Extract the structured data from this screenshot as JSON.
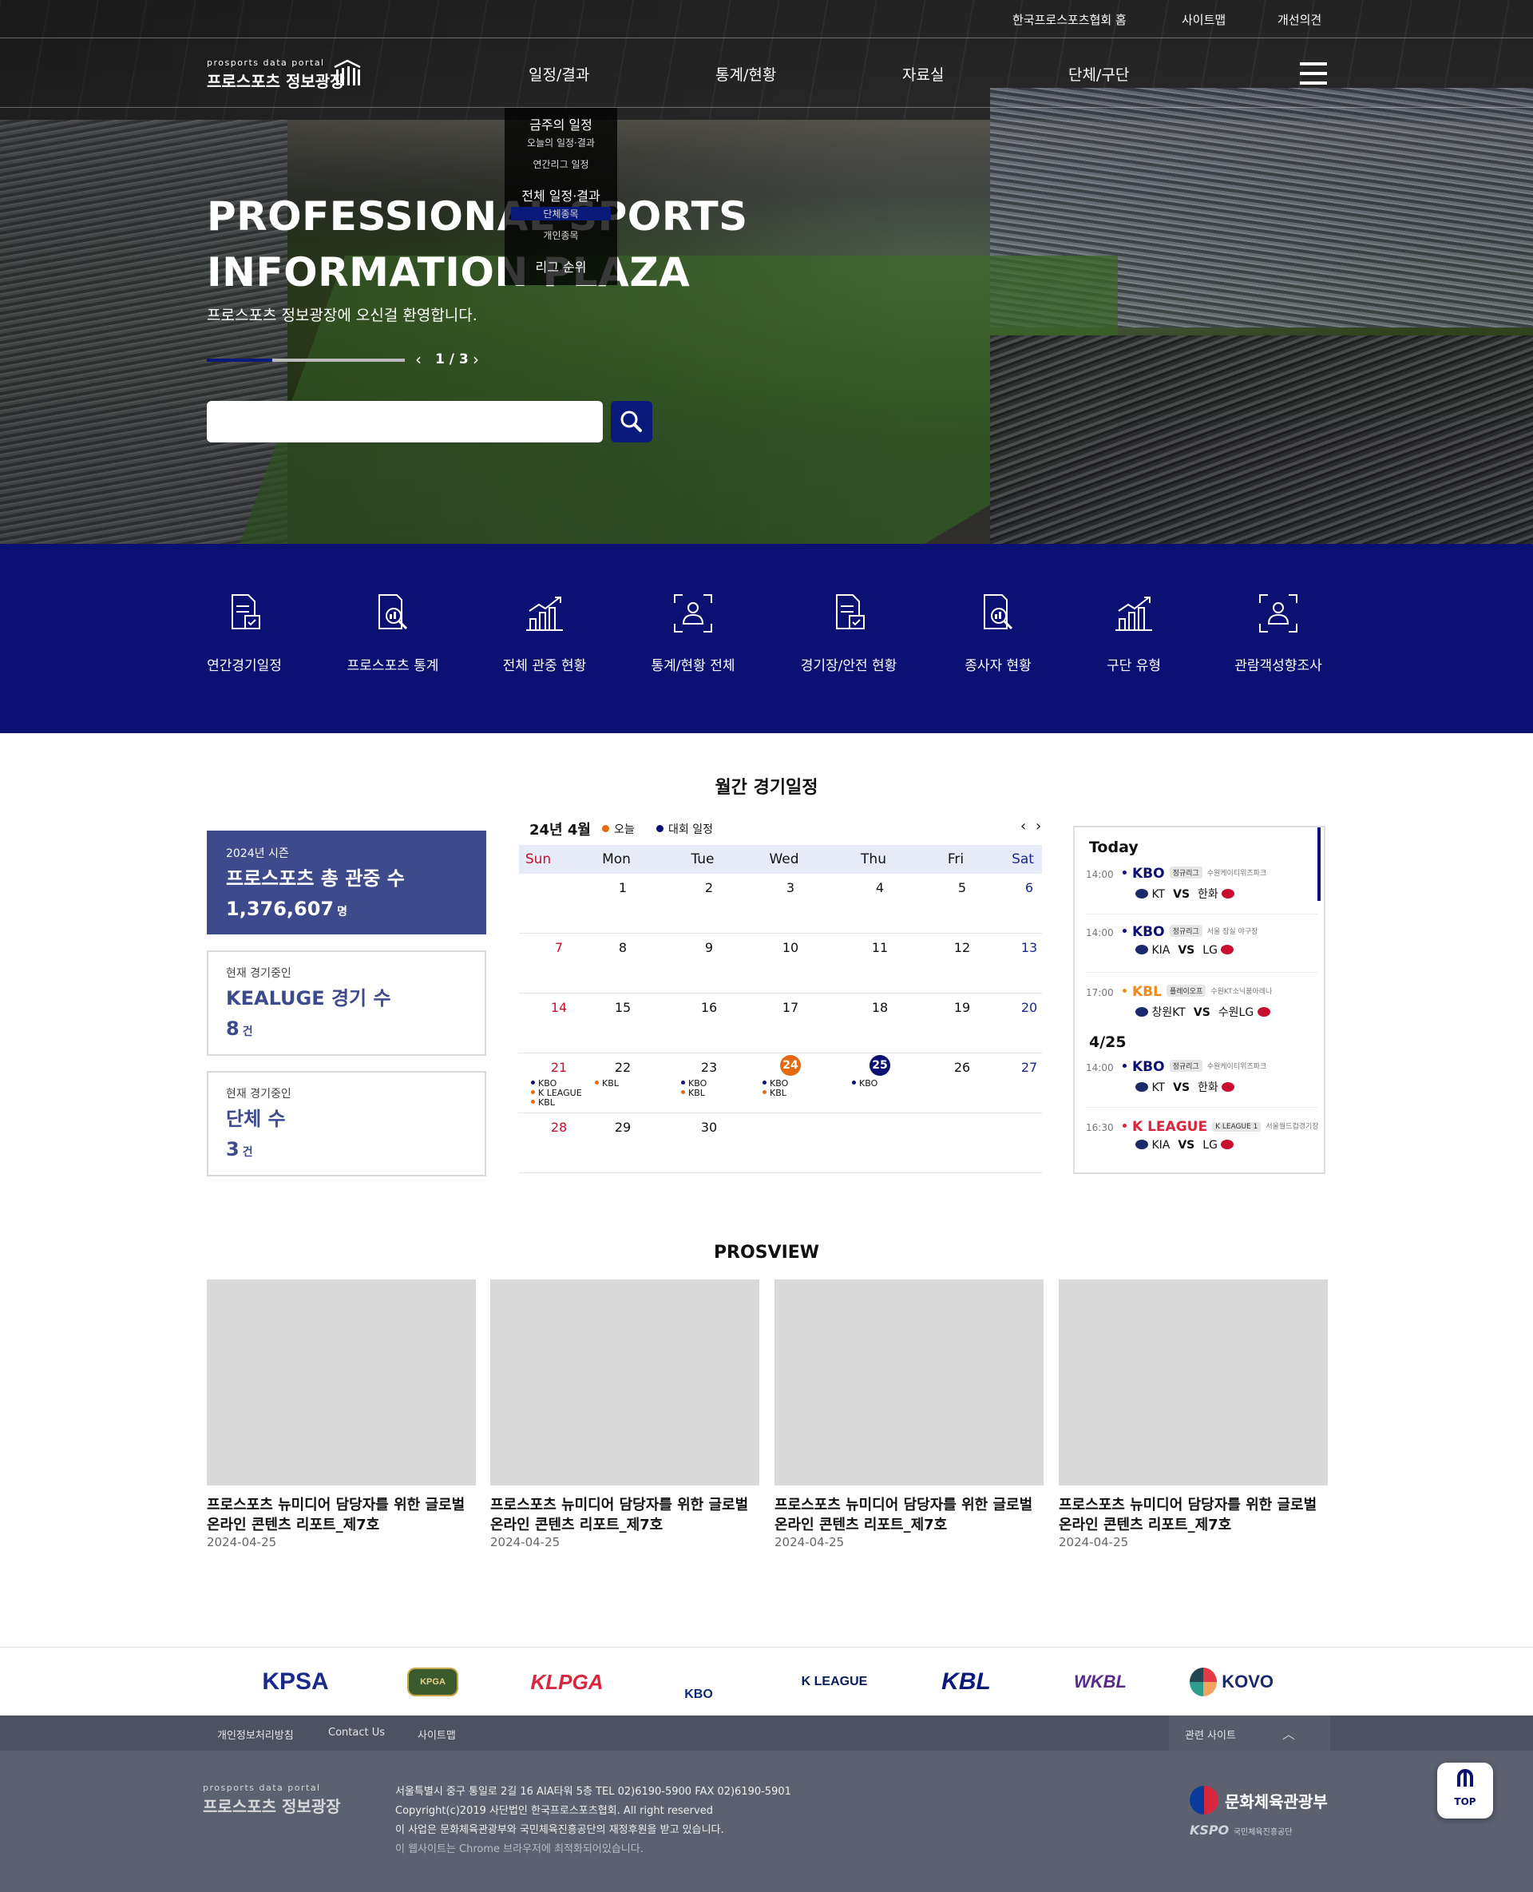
{
  "topbar": {
    "links": [
      "한국프로스포츠협회 홈",
      "사이트맵",
      "개선의견"
    ]
  },
  "logo": {
    "small": "prosports data portal",
    "big": "프로스포츠 정보광장"
  },
  "gnb": {
    "menus": [
      "일정/결과",
      "통계/현황",
      "자료실",
      "단체/구단"
    ]
  },
  "dropdown": {
    "items": [
      {
        "label": "금주의 일정",
        "level": "main"
      },
      {
        "label": "오늘의 일정·결과",
        "level": "sub"
      },
      {
        "label": "연간리그 일정",
        "level": "sub"
      },
      {
        "label": "전체 일정·결과",
        "level": "main"
      },
      {
        "label": "단체종목",
        "level": "sub",
        "highlight": true
      },
      {
        "label": "개인종목",
        "level": "sub"
      },
      {
        "label": "리그 순위",
        "level": "main"
      }
    ]
  },
  "hero": {
    "title_line1": "PROFESSIONAL SPORTS",
    "title_line2": "INFORMATION PLAZA",
    "subtitle": "프로스포츠 정보광장에 오신걸 환영합니다.",
    "pager": "1 / 3",
    "progress": 0.33,
    "search_placeholder": ""
  },
  "quick_menu": [
    {
      "label": "연간경기일정",
      "icon": "document-check-icon"
    },
    {
      "label": "프로스포츠 통계",
      "icon": "chart-search-icon"
    },
    {
      "label": "전체 관중 현황",
      "icon": "bar-chart-up-icon"
    },
    {
      "label": "통계/현황 전체",
      "icon": "person-frame-icon"
    },
    {
      "label": "경기장/안전 현황",
      "icon": "document-check-icon"
    },
    {
      "label": "종사자 현황",
      "icon": "chart-search-icon"
    },
    {
      "label": "구단 유형",
      "icon": "bar-chart-up-icon"
    },
    {
      "label": "관람객성향조사",
      "icon": "person-frame-icon"
    }
  ],
  "monthly": {
    "title": "월간 경기일정",
    "stats": [
      {
        "small": "2024년 시즌",
        "title": "프로스포츠 총 관중 수",
        "value": "1,376,607",
        "unit": "명"
      },
      {
        "small": "현재 경기중인",
        "title": "KEALUGE 경기 수",
        "value": "8",
        "unit": "건"
      },
      {
        "small": "현재 경기중인",
        "title": "단체 수",
        "value": "3",
        "unit": "건"
      }
    ],
    "calendar": {
      "month_label": "24년 4월",
      "legend_today": "오늘",
      "legend_event": "대회 일정",
      "today_color": "#e46a12",
      "event_color": "#0a1172",
      "daynames": [
        "Sun",
        "Mon",
        "Tue",
        "Wed",
        "Thu",
        "Fri",
        "Sat"
      ],
      "weeks": [
        [
          "",
          "1",
          "2",
          "3",
          "4",
          "5",
          "6"
        ],
        [
          "7",
          "8",
          "9",
          "10",
          "11",
          "12",
          "13"
        ],
        [
          "14",
          "15",
          "16",
          "17",
          "18",
          "19",
          "20"
        ],
        [
          "21",
          "22",
          "23",
          "24",
          "25",
          "26",
          "27"
        ],
        [
          "28",
          "29",
          "30",
          "",
          "",
          "",
          ""
        ]
      ],
      "events": {
        "21": [
          "KBO",
          "K LEAGUE",
          "KBL"
        ],
        "22": [
          "KBL"
        ],
        "23": [
          "KBO",
          "KBL"
        ],
        "24": [
          "KBO",
          "KBL"
        ],
        "25": [
          "KBO"
        ]
      }
    },
    "today_panel": {
      "today_label": "Today",
      "date_label": "4/25",
      "games": [
        {
          "time": "14:00",
          "league": "KBO",
          "tag": "정규리그",
          "venue": "수원케이티위즈파크",
          "home": "KT",
          "vs": "VS",
          "away": "한화",
          "color": "#0a1172"
        },
        {
          "time": "14:00",
          "league": "KBO",
          "tag": "정규리그",
          "venue": "서울 잠실 야구장",
          "home": "KIA",
          "vs": "VS",
          "away": "LG",
          "color": "#0a1172"
        },
        {
          "time": "17:00",
          "league": "KBL",
          "tag": "플레이오프",
          "venue": "수원KT소닉붐아레나",
          "home": "창원KT",
          "vs": "VS",
          "away": "수원LG",
          "color": "#f08a1c"
        },
        {
          "time": "14:00",
          "league": "KBO",
          "tag": "정규리그",
          "venue": "수원케이티위즈파크",
          "home": "KT",
          "vs": "VS",
          "away": "한화",
          "color": "#0a1172"
        },
        {
          "time": "16:30",
          "league": "K LEAGUE",
          "tag": "K LEAGUE 1",
          "venue": "서울월드컵경기장",
          "home": "KIA",
          "vs": "VS",
          "away": "LG",
          "color": "#d7263d"
        }
      ]
    }
  },
  "prosview": {
    "title": "PROSVIEW",
    "cards": [
      {
        "title": "프로스포츠 뉴미디어 담당자를 위한 글로벌 온라인 콘텐츠 리포트_제7호",
        "date": "2024-04-25"
      },
      {
        "title": "프로스포츠 뉴미디어 담당자를 위한 글로벌 온라인 콘텐츠 리포트_제7호",
        "date": "2024-04-25"
      },
      {
        "title": "프로스포츠 뉴미디어 담당자를 위한 글로벌 온라인 콘텐츠 리포트_제7호",
        "date": "2024-04-25"
      },
      {
        "title": "프로스포츠 뉴미디어 담당자를 위한 글로벌 온라인 콘텐츠 리포트_제7호",
        "date": "2024-04-25"
      }
    ]
  },
  "partners": [
    "KPSA",
    "KPGA",
    "KLPGA",
    "KBO",
    "K LEAGUE",
    "KBL",
    "WKBL",
    "KOVO"
  ],
  "footer": {
    "links": [
      "개인정보처리방침",
      "Contact Us",
      "사이트맵"
    ],
    "related": "관련 사이트",
    "lines": [
      "서울특별시 중구 통일로 2길 16 AIA타워 5층 TEL 02)6190-5900 FAX 02)6190-5901",
      "Copyright(c)2019 사단법인 한국프로스포츠협회. All right reserved",
      "이 사업은 문화체육관광부와 국민체육진흥공단의 재정후원을 받고 있습니다.",
      "이 웹사이트는 Chrome 브라우저에 최적화되어있습니다."
    ],
    "org1": "문화체육관광부",
    "org2": "KSPO",
    "org2_sub": "국민체육진흥공단"
  },
  "top_button": "TOP"
}
